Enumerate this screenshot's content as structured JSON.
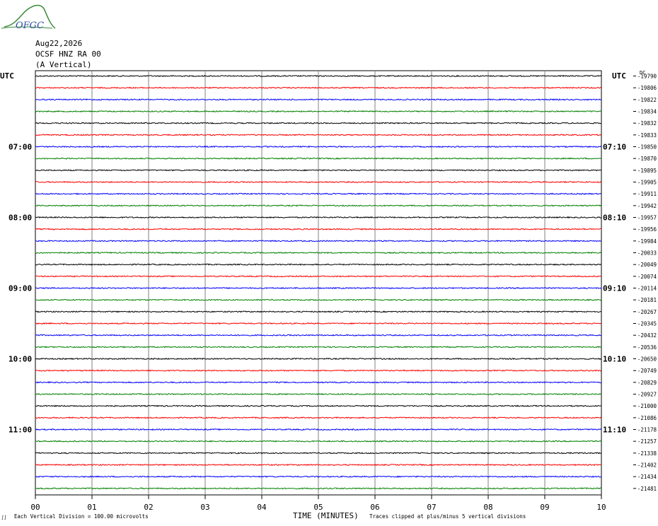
{
  "logo_text": "OFGC",
  "header": {
    "date": "Aug22,2026",
    "station": "OCSF HNZ RA 00",
    "component": "(A Vertical)"
  },
  "utc_label_left": "UTC",
  "utc_label_right": "UTC",
  "dc_label": "DC",
  "footer": {
    "left_mark": "∫∫",
    "scale": "Each Vertical Division =  100.00 microvolts",
    "xlabel": "TIME (MINUTES)",
    "clip_note": "Traces clipped at plus/minus 5 vertical divisions"
  },
  "colors": {
    "trace_cycle": [
      "#000000",
      "#ff0000",
      "#0000ff",
      "#008000"
    ],
    "grid": "#808080"
  },
  "chart_data": {
    "type": "line",
    "title": "OCSF HNZ RA 00",
    "xlabel": "TIME (MINUTES)",
    "xlim": [
      0,
      10
    ],
    "x_ticks": [
      "00",
      "01",
      "02",
      "03",
      "04",
      "05",
      "06",
      "07",
      "08",
      "09",
      "10"
    ],
    "left_time_labels": [
      {
        "row": 6,
        "text": "07:00"
      },
      {
        "row": 12,
        "text": "08:00"
      },
      {
        "row": 18,
        "text": "09:00"
      },
      {
        "row": 24,
        "text": "10:00"
      },
      {
        "row": 30,
        "text": "11:00"
      }
    ],
    "right_time_labels": [
      {
        "row": 6,
        "text": "07:10"
      },
      {
        "row": 12,
        "text": "08:10"
      },
      {
        "row": 18,
        "text": "09:10"
      },
      {
        "row": 24,
        "text": "10:10"
      },
      {
        "row": 30,
        "text": "11:10"
      }
    ],
    "dc_offsets": [
      "-19790",
      "-19806",
      "-19822",
      "-19834",
      "-19832",
      "-19833",
      "-19850",
      "-19870",
      "-19895",
      "-19905",
      "-19911",
      "-19942",
      "-19957",
      "-19956",
      "-19984",
      "-20033",
      "-20049",
      "-20074",
      "-20114",
      "-20181",
      "-20267",
      "-20345",
      "-20432",
      "-20536",
      "-20650",
      "-20749",
      "-20829",
      "-20927",
      "-21000",
      "-21086",
      "-21178",
      "-21257",
      "-21338",
      "-21402",
      "-21434",
      "-21481"
    ]
  }
}
